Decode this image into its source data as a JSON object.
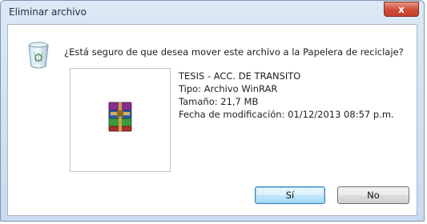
{
  "window": {
    "title": "Eliminar archivo",
    "close_label": "x"
  },
  "dialog": {
    "question": "¿Está seguro de que desea mover este archivo a la Papelera de reciclaje?",
    "file": {
      "name": "TESIS - ACC. DE TRANSITO",
      "type": "Tipo: Archivo WinRAR",
      "size": "Tamaño: 21,7 MB",
      "modified": "Fecha de modificación: 01/12/2013 08:57 p.m."
    },
    "icons": {
      "header": "recycle-bin-icon",
      "file": "winrar-archive-icon"
    }
  },
  "buttons": {
    "yes_label": "Sí",
    "no_label": "No"
  },
  "colors": {
    "title_bar": "#c9dbee",
    "close_button": "#cf4b37",
    "default_button": "#bee6fd"
  }
}
